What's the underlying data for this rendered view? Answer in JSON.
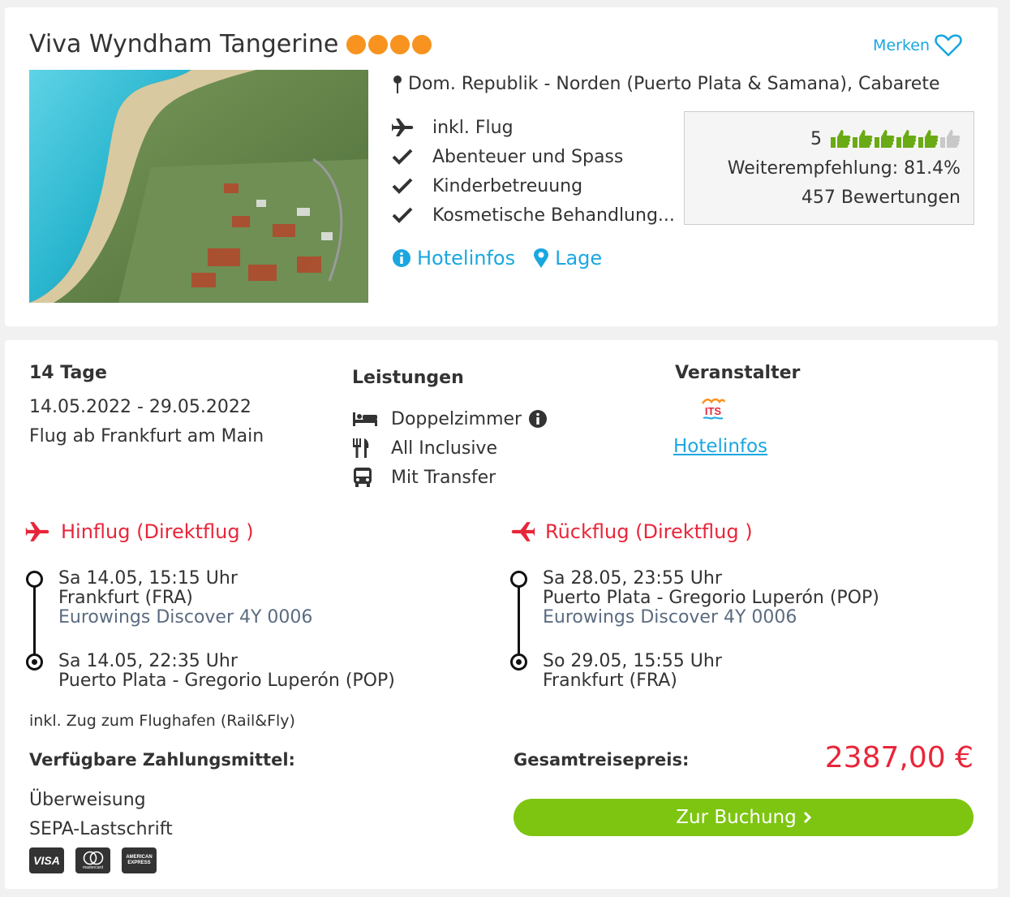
{
  "hotel": {
    "name": "Viva Wyndham Tangerine",
    "stars": 4,
    "merken_label": "Merken",
    "location": "Dom. Republik - Norden (Puerto Plata & Samana), Cabarete",
    "features": [
      {
        "icon": "plane-icon",
        "label": "inkl. Flug"
      },
      {
        "icon": "check-icon",
        "label": "Abenteuer und Spass"
      },
      {
        "icon": "check-icon",
        "label": "Kinderbetreuung"
      },
      {
        "icon": "check-icon",
        "label": "Kosmetische Behandlung..."
      }
    ],
    "rating": {
      "score": "5",
      "thumbs_filled": 5,
      "thumbs_total": 6,
      "recommendation": "Weiterempfehlung: 81.4%",
      "reviews": "457 Bewertungen"
    },
    "links": {
      "hotelinfos": "Hotelinfos",
      "lage": "Lage"
    }
  },
  "offer": {
    "duration": "14 Tage",
    "dates": "14.05.2022 - 29.05.2022",
    "departure": "Flug ab Frankfurt am Main",
    "leistungen_heading": "Leistungen",
    "leistungen": [
      {
        "icon": "bed-icon",
        "label": "Doppelzimmer"
      },
      {
        "icon": "cutlery-icon",
        "label": "All Inclusive"
      },
      {
        "icon": "bus-icon",
        "label": "Mit Transfer"
      }
    ],
    "veranstalter_heading": "Veranstalter",
    "veranstalter_logo": "ITS",
    "veranstalter_link": "Hotelinfos"
  },
  "flights": {
    "outbound": {
      "heading": "Hinflug (Direktflug )",
      "departure": {
        "time": "Sa 14.05, 15:15 Uhr",
        "airport": "Frankfurt (FRA)",
        "carrier": "Eurowings Discover 4Y 0006"
      },
      "arrival": {
        "time": "Sa 14.05, 22:35 Uhr",
        "airport": "Puerto Plata - Gregorio Luperón (POP)"
      }
    },
    "return": {
      "heading": "Rückflug (Direktflug )",
      "departure": {
        "time": "Sa 28.05, 23:55 Uhr",
        "airport": "Puerto Plata - Gregorio Luperón (POP)",
        "carrier": "Eurowings Discover 4Y 0006"
      },
      "arrival": {
        "time": "So 29.05, 15:55 Uhr",
        "airport": "Frankfurt (FRA)"
      }
    },
    "rail_note": "inkl. Zug zum Flughafen (Rail&Fly)"
  },
  "payment": {
    "heading": "Verfügbare Zahlungsmittel:",
    "methods": [
      "Überweisung",
      "SEPA-Lastschrift"
    ],
    "cards": [
      "VISA",
      "mastercard",
      "AMERICAN EXPRESS"
    ]
  },
  "price": {
    "label": "Gesamtreisepreis:",
    "value": "2387,00 €",
    "book_label": "Zur Buchung"
  },
  "colors": {
    "accent_blue": "#1aa7e0",
    "red": "#e8263a",
    "green_button": "#7dc511",
    "star_orange": "#f7931e",
    "thumb_green": "#6aaa14"
  }
}
